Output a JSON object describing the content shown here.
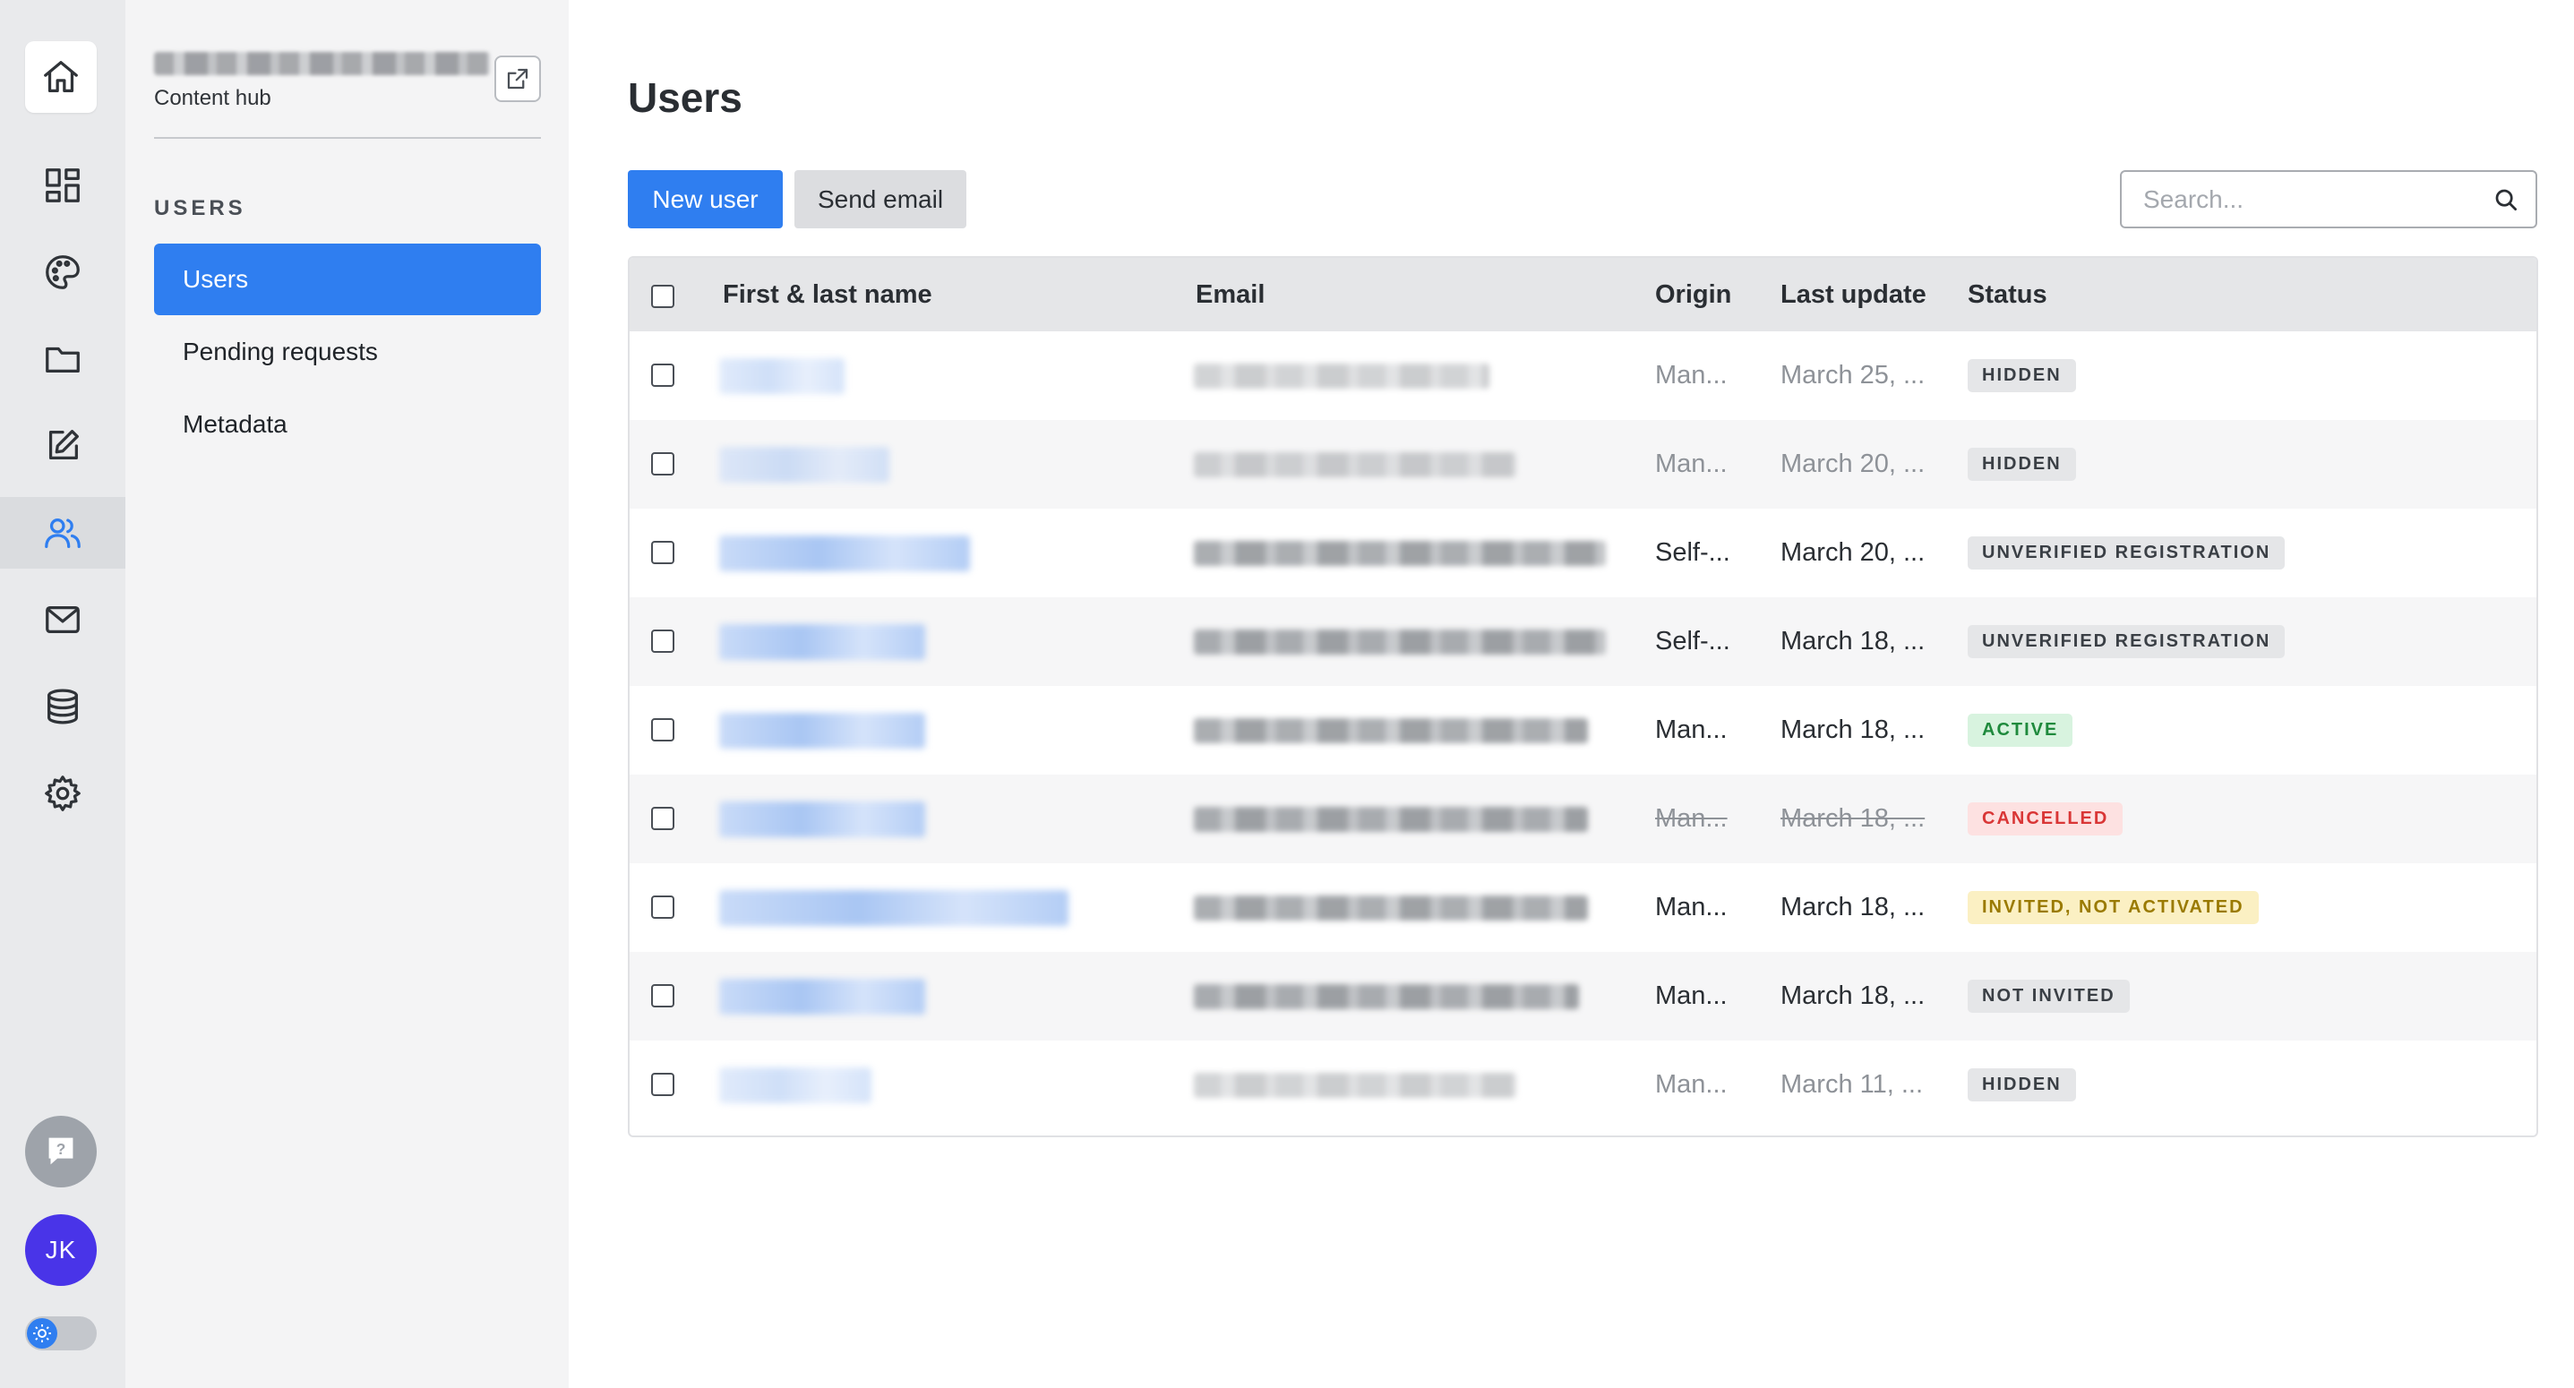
{
  "sidebar": {
    "project_hub": "Content hub",
    "section_heading": "USERS",
    "items": [
      {
        "label": "Users",
        "active": true
      },
      {
        "label": "Pending requests",
        "active": false
      },
      {
        "label": "Metadata",
        "active": false
      }
    ]
  },
  "rail": {
    "icons": [
      "home-icon",
      "dashboard-icon",
      "palette-icon",
      "folder-icon",
      "edit-icon",
      "users-icon",
      "mail-icon",
      "database-icon",
      "gear-icon"
    ],
    "active": "users-icon",
    "avatar_initials": "JK"
  },
  "main": {
    "title": "Users",
    "new_user_label": "New user",
    "send_email_label": "Send email",
    "search_placeholder": "Search..."
  },
  "table": {
    "columns": [
      "First & last name",
      "Email",
      "Origin",
      "Last update",
      "Status"
    ],
    "rows": [
      {
        "origin": "Man...",
        "last_update": "March 25, ...",
        "status": "HIDDEN",
        "status_type": "hidden",
        "style": "dim"
      },
      {
        "origin": "Man...",
        "last_update": "March 20, ...",
        "status": "HIDDEN",
        "status_type": "hidden",
        "style": "dim"
      },
      {
        "origin": "Self-...",
        "last_update": "March 20, ...",
        "status": "UNVERIFIED REGISTRATION",
        "status_type": "neutral",
        "style": "normal"
      },
      {
        "origin": "Self-...",
        "last_update": "March 18, ...",
        "status": "UNVERIFIED REGISTRATION",
        "status_type": "neutral",
        "style": "normal"
      },
      {
        "origin": "Man...",
        "last_update": "March 18, ...",
        "status": "ACTIVE",
        "status_type": "active",
        "style": "normal"
      },
      {
        "origin": "Man...",
        "last_update": "March 18, ...",
        "status": "CANCELLED",
        "status_type": "cancelled",
        "style": "struck"
      },
      {
        "origin": "Man...",
        "last_update": "March 18, ...",
        "status": "INVITED, NOT ACTIVATED",
        "status_type": "invited",
        "style": "normal"
      },
      {
        "origin": "Man...",
        "last_update": "March 18, ...",
        "status": "NOT INVITED",
        "status_type": "neutral",
        "style": "normal"
      },
      {
        "origin": "Man...",
        "last_update": "March 11, ...",
        "status": "HIDDEN",
        "status_type": "hidden",
        "style": "dim"
      }
    ]
  },
  "colors": {
    "accent": "#2f7ef0",
    "avatar": "#4934e8",
    "active_badge": "#1f8a3d",
    "cancelled_badge": "#d93636",
    "invited_badge": "#9a7a00"
  }
}
